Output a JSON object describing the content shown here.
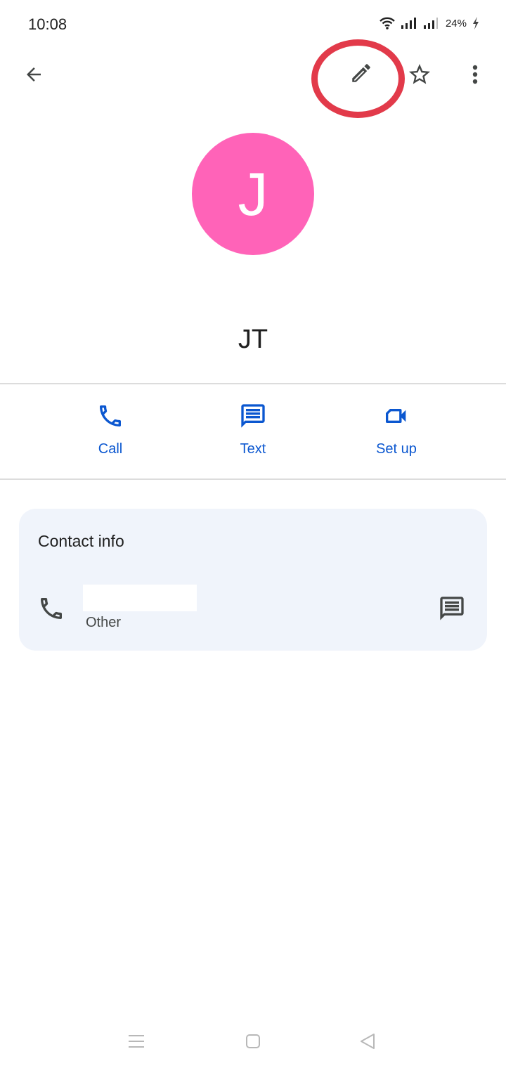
{
  "status_bar": {
    "time": "10:08",
    "battery_percent": "24%",
    "icons": [
      "wifi-icon",
      "signal-icon",
      "signal-icon",
      "battery-charging-icon"
    ]
  },
  "top_bar": {
    "back_icon": "arrow-left-icon",
    "edit_icon": "pencil-icon",
    "star_icon": "star-outline-icon",
    "more_icon": "more-vert-icon",
    "highlight_color": "#e23a4a"
  },
  "contact": {
    "avatar_letter": "J",
    "avatar_color": "#ff63b8",
    "name": "JT"
  },
  "actions": [
    {
      "label": "Call",
      "icon": "phone-icon"
    },
    {
      "label": "Text",
      "icon": "message-icon"
    },
    {
      "label": "Set up",
      "icon": "video-call-icon"
    }
  ],
  "accent_color": "#0b57d0",
  "contact_info": {
    "title": "Contact info",
    "phone": {
      "number": "",
      "type": "Other",
      "redacted": true
    }
  },
  "nav_bar": {
    "icons": [
      "menu-icon",
      "home-icon",
      "back-icon"
    ]
  }
}
